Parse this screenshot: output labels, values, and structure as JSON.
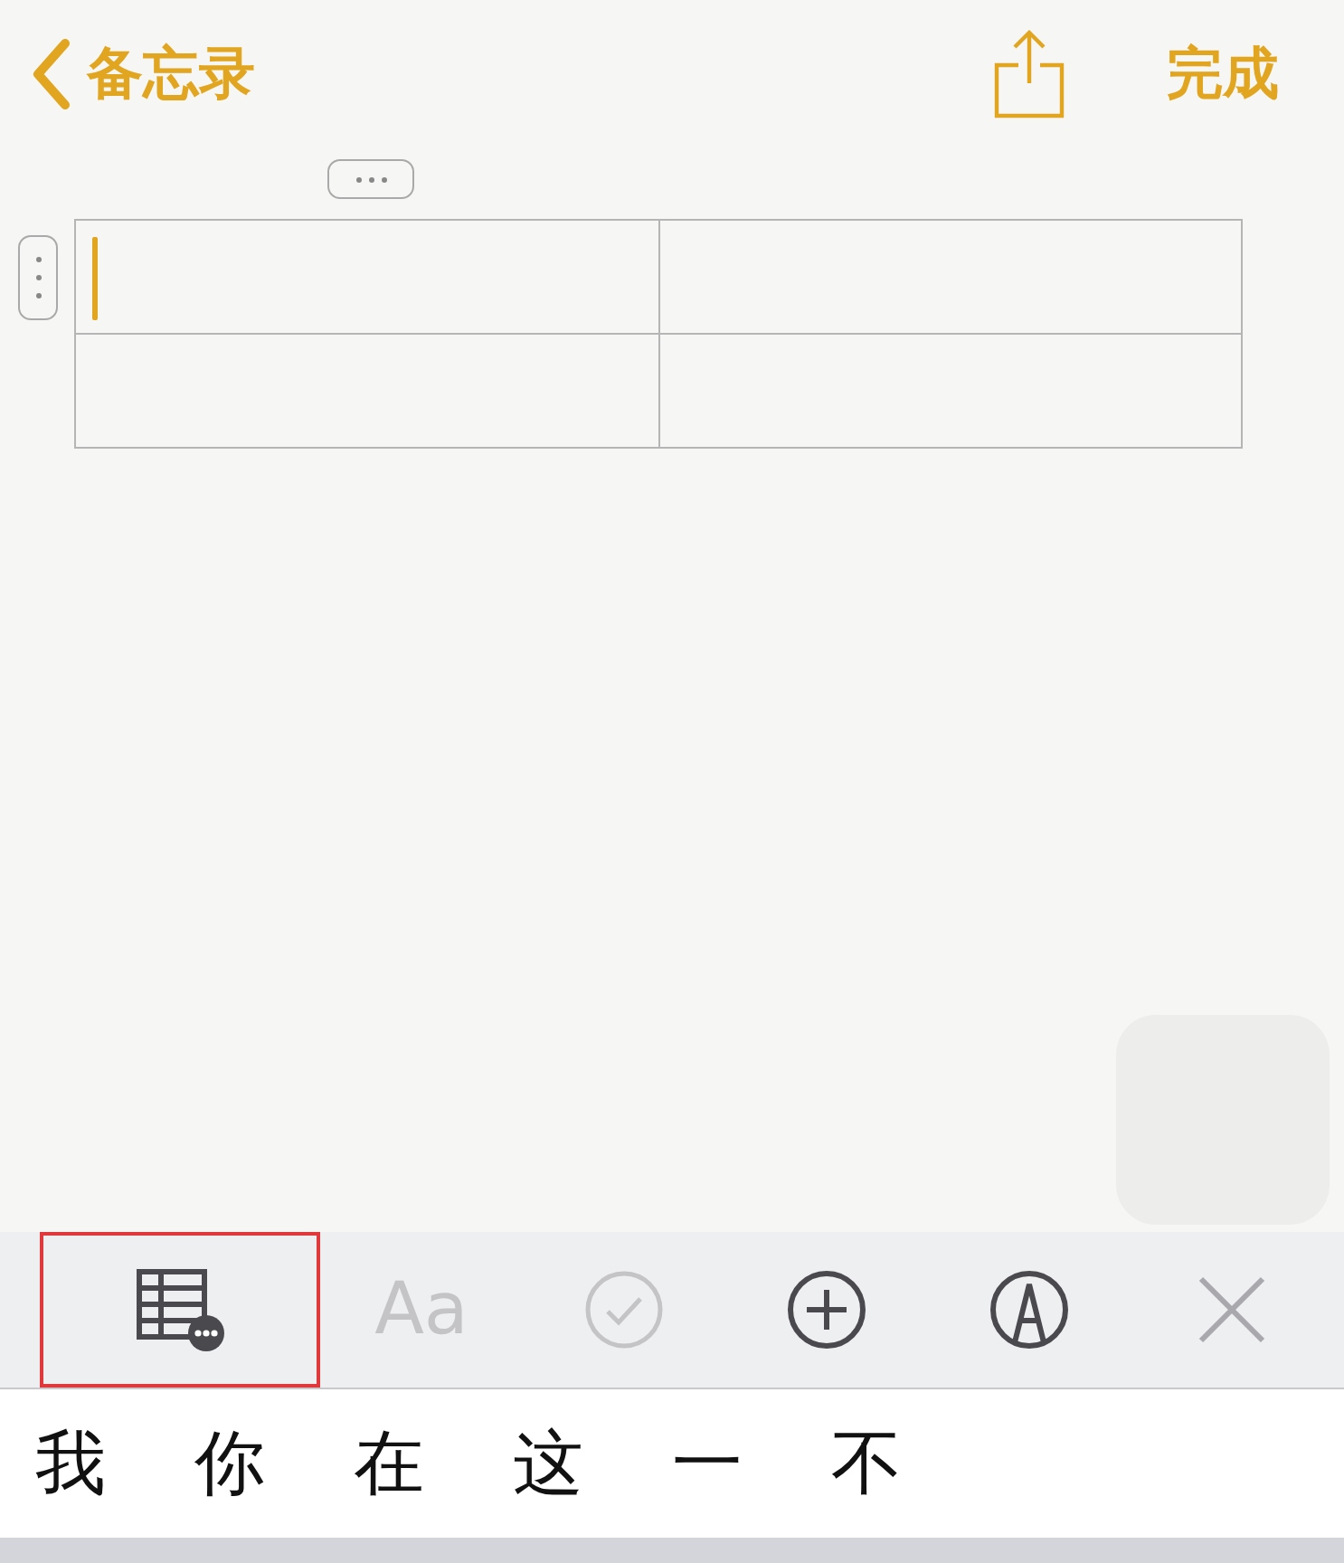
{
  "nav": {
    "back_label": "备忘录",
    "done_label": "完成"
  },
  "table": {
    "rows": [
      {
        "cells": [
          {
            "cursor": true
          },
          {
            "cursor": false
          }
        ]
      },
      {
        "cells": [
          {
            "cursor": false
          },
          {
            "cursor": false
          }
        ]
      }
    ]
  },
  "toolbar": [
    {
      "kind": "table",
      "selected": true,
      "disabled": false
    },
    {
      "kind": "format",
      "label": "Aa",
      "selected": false,
      "disabled": true
    },
    {
      "kind": "checklist",
      "selected": false,
      "disabled": true
    },
    {
      "kind": "add",
      "selected": false,
      "disabled": false
    },
    {
      "kind": "markup",
      "selected": false,
      "disabled": false
    },
    {
      "kind": "close",
      "selected": false,
      "disabled": false
    }
  ],
  "candidates": [
    "我",
    "你",
    "在",
    "这",
    "一",
    "不"
  ]
}
